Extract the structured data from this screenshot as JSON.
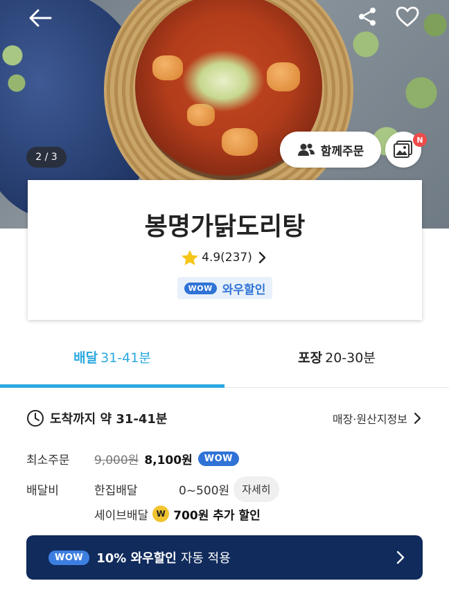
{
  "hero": {
    "page_counter": "2 / 3",
    "group_order_label": "함께주문",
    "new_badge": "N"
  },
  "store": {
    "name": "봉명가닭도리탕",
    "rating": "4.9(237)",
    "wow_pill": "WOW",
    "wow_discount_label": "와우할인"
  },
  "tabs": {
    "delivery": {
      "label": "배달",
      "time": "31-41분"
    },
    "takeout": {
      "label": "포장",
      "time": "20-30분"
    }
  },
  "info": {
    "arrival_text": "도착까지 약 31-41분",
    "store_info_link": "매장·원산지정보",
    "min_order_label": "최소주문",
    "min_order_original": "9,000원",
    "min_order_price": "8,100원",
    "min_order_wow": "WOW",
    "delivery_fee_label": "배달비",
    "single_delivery": "한집배달",
    "single_delivery_fee": "0~500원",
    "detail_button": "자세히",
    "save_delivery": "세이브배달",
    "save_coin": "W",
    "save_discount": "700원 추가 할인"
  },
  "banner": {
    "wow_pill": "WOW",
    "strong": "10% 와우할인",
    "normal": "자동 적용"
  },
  "colors": {
    "accent": "#2aa8e0",
    "wow_blue": "#2f73d6",
    "banner_bg": "#102b5c",
    "badge_red": "#ef4a4a"
  }
}
